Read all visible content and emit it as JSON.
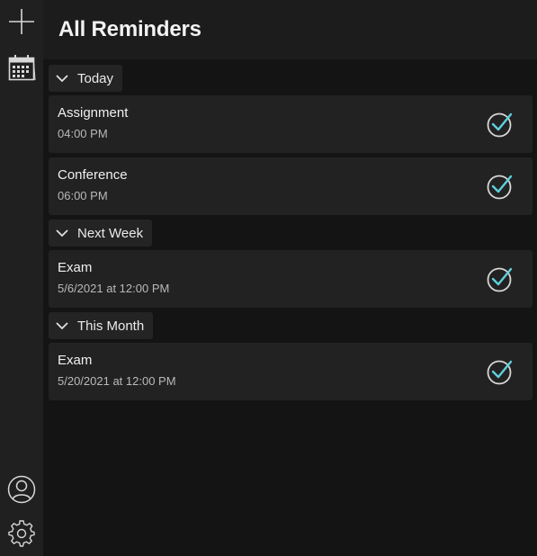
{
  "header": {
    "title": "All Reminders"
  },
  "rail": {
    "top_icons": [
      "plus-icon",
      "calendar-icon"
    ],
    "bottom_icons": [
      "user-icon",
      "gear-icon"
    ]
  },
  "colors": {
    "accent": "#5fd0dc",
    "background": "#141414",
    "card": "#222222",
    "header": "#1c1c1c",
    "rail": "#202020"
  },
  "groups": [
    {
      "label": "Today",
      "items": [
        {
          "title": "Assignment",
          "time": "04:00 PM"
        },
        {
          "title": "Conference",
          "time": "06:00 PM"
        }
      ]
    },
    {
      "label": "Next Week",
      "items": [
        {
          "title": "Exam",
          "time": "5/6/2021 at 12:00 PM"
        }
      ]
    },
    {
      "label": "This Month",
      "items": [
        {
          "title": "Exam",
          "time": "5/20/2021 at 12:00 PM"
        }
      ]
    }
  ]
}
